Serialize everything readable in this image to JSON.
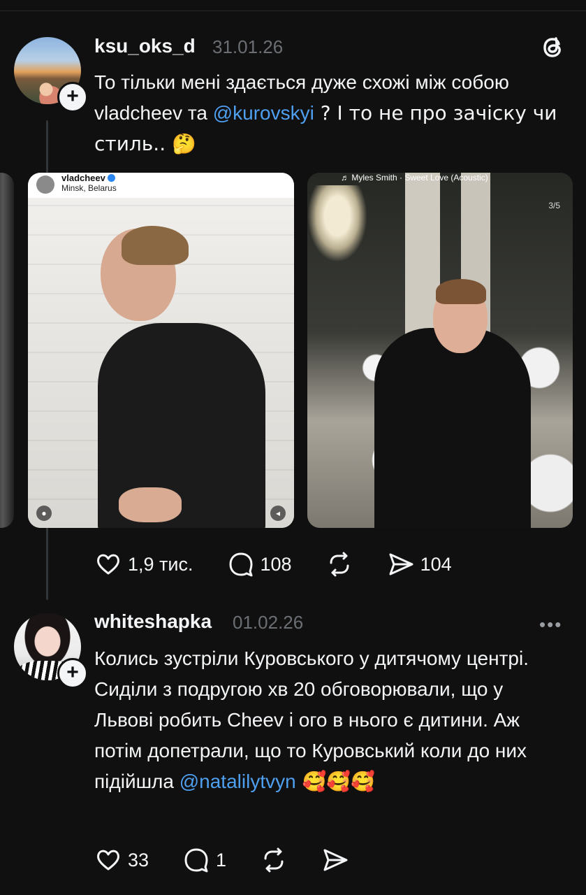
{
  "post1": {
    "username": "ksu_oks_d",
    "date": "31.01.26",
    "text_part1": "То тільки мені здається дуже схожі між собою vladcheev та ",
    "mention": "@kurovskyi",
    "text_part2": " ? І то не про зачіску чи стиль.. 🤔",
    "media": [
      {
        "username": "vladcheev",
        "location": "Minsk, Belarus"
      },
      {
        "music": "♬ Myles Smith · Sweet Love (Acoustic)",
        "counter": "3/5"
      }
    ],
    "actions": {
      "likes": "1,9 тис.",
      "comments": "108",
      "shares": "104"
    }
  },
  "post2": {
    "username": "whiteshapka",
    "date": "01.02.26",
    "text": "Колись зустріли Куровського у дитячому центрі. Сиділи з подругою хв 20 обговорювали, що у Львові робить Cheev і ого в нього є дитини. Аж потім допетрали, що то Куровський коли до них підійшла ",
    "mention": "@natalilytvyn",
    "emojis": " 🥰🥰🥰",
    "actions": {
      "likes": "33",
      "comments": "1"
    }
  },
  "icons": {
    "logo": "threads-logo-icon",
    "more": "more-icon",
    "like": "heart-icon",
    "comment": "comment-icon",
    "repost": "repost-icon",
    "share": "send-icon"
  },
  "colors": {
    "background": "#101010",
    "text": "#f3f5f7",
    "mention": "#4f9ff0",
    "muted": "#6b6f74"
  }
}
